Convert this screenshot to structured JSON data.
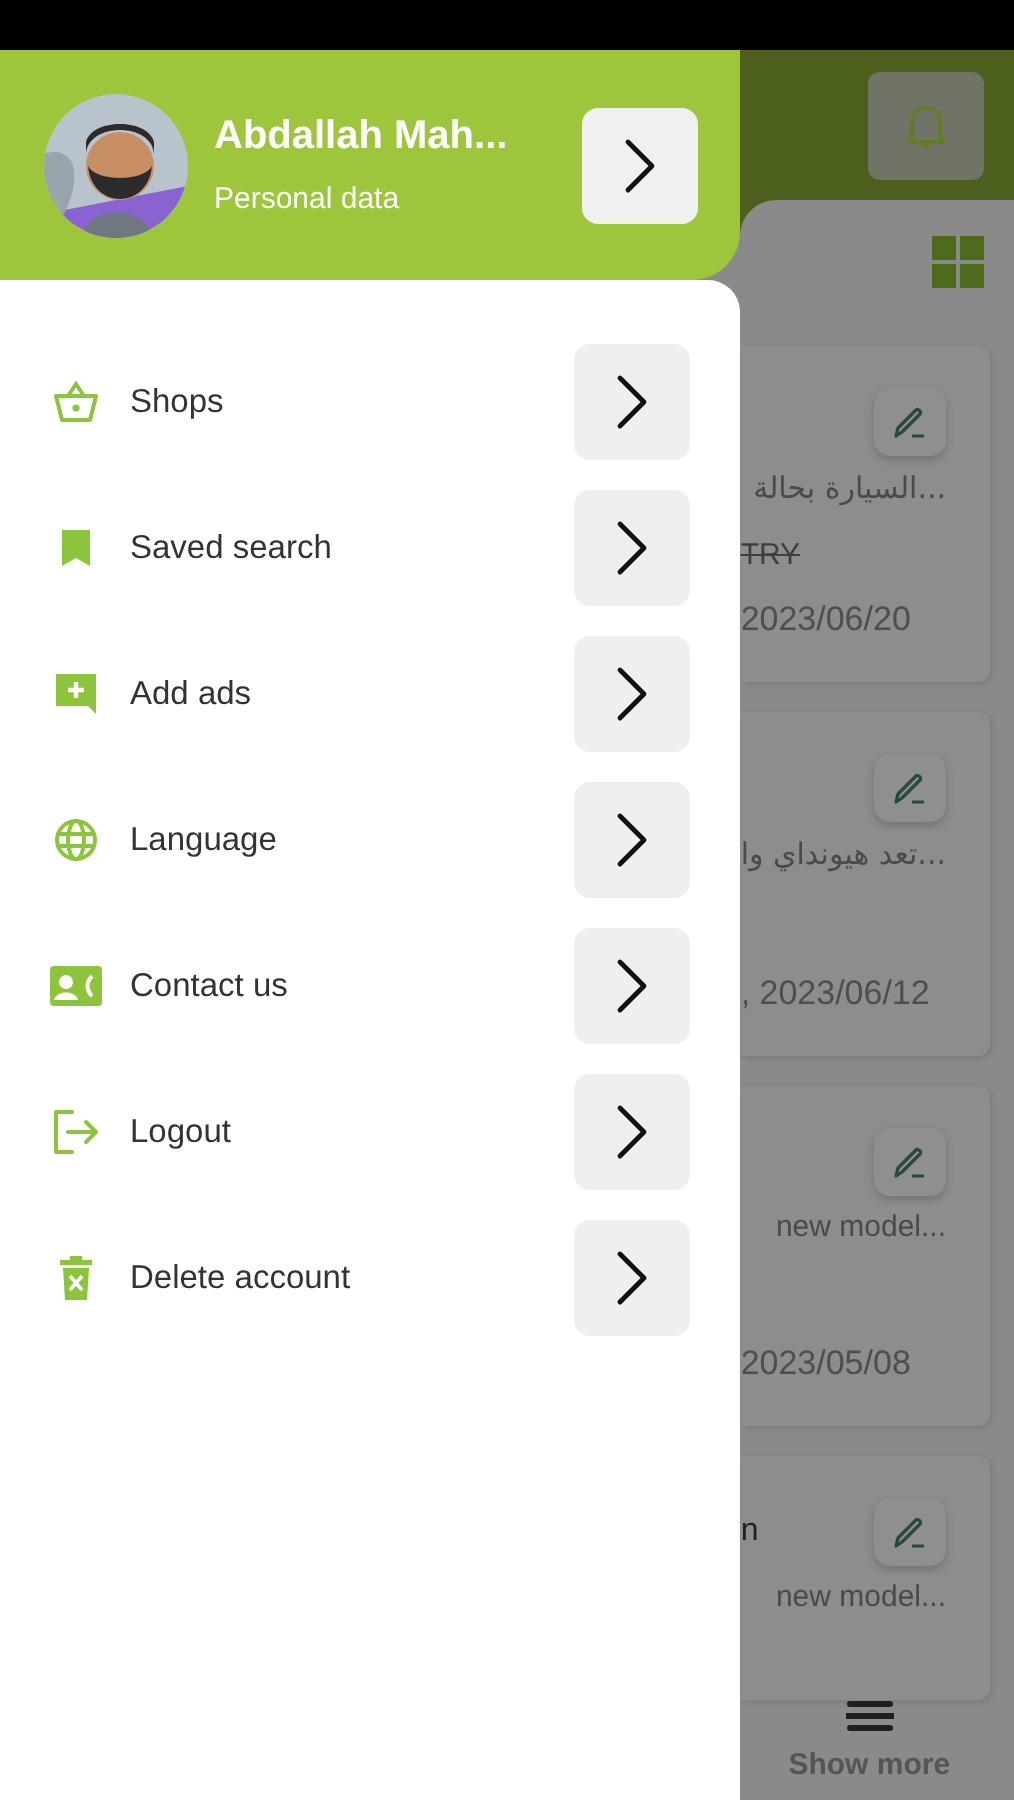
{
  "drawer": {
    "profile": {
      "name": "Abdallah Mah...",
      "subtitle": "Personal data"
    },
    "items": [
      {
        "label": "Shops",
        "kind": "basket"
      },
      {
        "label": "Saved search",
        "kind": "bookmark"
      },
      {
        "label": "Add ads",
        "kind": "add-message"
      },
      {
        "label": "Language",
        "kind": "globe"
      },
      {
        "label": "Contact us",
        "kind": "contact"
      },
      {
        "label": "Logout",
        "kind": "logout"
      },
      {
        "label": "Delete account",
        "kind": "trash"
      }
    ]
  },
  "listings": {
    "cards": [
      {
        "description": "...السيارة بحالة",
        "price": "TRY",
        "date": "2023/06/20"
      },
      {
        "description": "...تعد هيونداي وا",
        "date": ", 2023/06/12"
      },
      {
        "description": "new model...",
        "date": "2023/05/08"
      },
      {
        "title": "n",
        "description": "new model..."
      }
    ],
    "show_more": "Show more"
  }
}
